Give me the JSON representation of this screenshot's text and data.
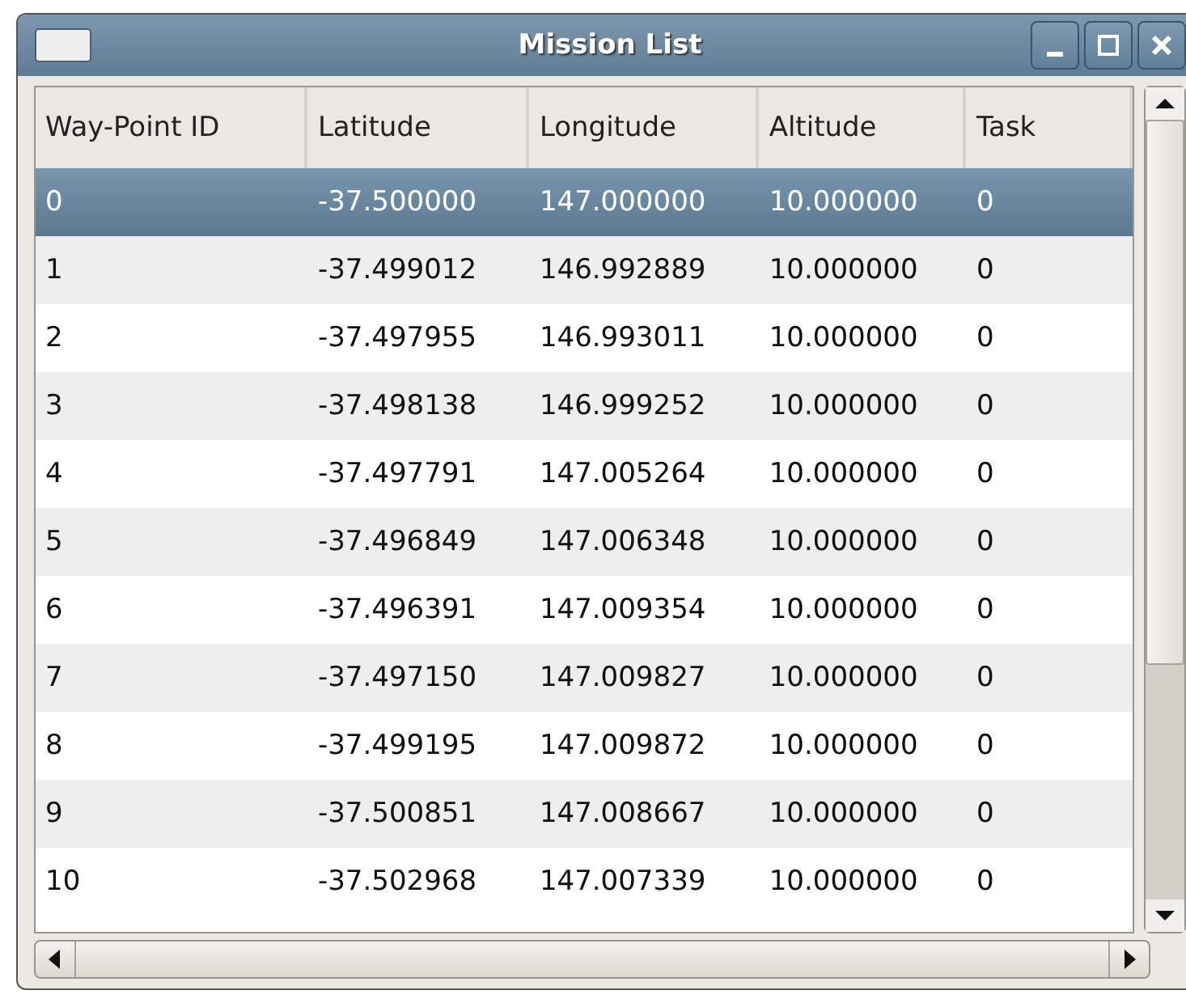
{
  "window": {
    "title": "Mission List"
  },
  "table": {
    "columns": [
      "Way-Point ID",
      "Latitude",
      "Longitude",
      "Altitude",
      "Task"
    ],
    "rows": [
      {
        "selected": true,
        "cells": [
          "0",
          "-37.500000",
          "147.000000",
          "10.000000",
          "0"
        ]
      },
      {
        "selected": false,
        "cells": [
          "1",
          "-37.499012",
          "146.992889",
          "10.000000",
          "0"
        ]
      },
      {
        "selected": false,
        "cells": [
          "2",
          "-37.497955",
          "146.993011",
          "10.000000",
          "0"
        ]
      },
      {
        "selected": false,
        "cells": [
          "3",
          "-37.498138",
          "146.999252",
          "10.000000",
          "0"
        ]
      },
      {
        "selected": false,
        "cells": [
          "4",
          "-37.497791",
          "147.005264",
          "10.000000",
          "0"
        ]
      },
      {
        "selected": false,
        "cells": [
          "5",
          "-37.496849",
          "147.006348",
          "10.000000",
          "0"
        ]
      },
      {
        "selected": false,
        "cells": [
          "6",
          "-37.496391",
          "147.009354",
          "10.000000",
          "0"
        ]
      },
      {
        "selected": false,
        "cells": [
          "7",
          "-37.497150",
          "147.009827",
          "10.000000",
          "0"
        ]
      },
      {
        "selected": false,
        "cells": [
          "8",
          "-37.499195",
          "147.009872",
          "10.000000",
          "0"
        ]
      },
      {
        "selected": false,
        "cells": [
          "9",
          "-37.500851",
          "147.008667",
          "10.000000",
          "0"
        ]
      },
      {
        "selected": false,
        "cells": [
          "10",
          "-37.502968",
          "147.007339",
          "10.000000",
          "0"
        ]
      }
    ]
  }
}
